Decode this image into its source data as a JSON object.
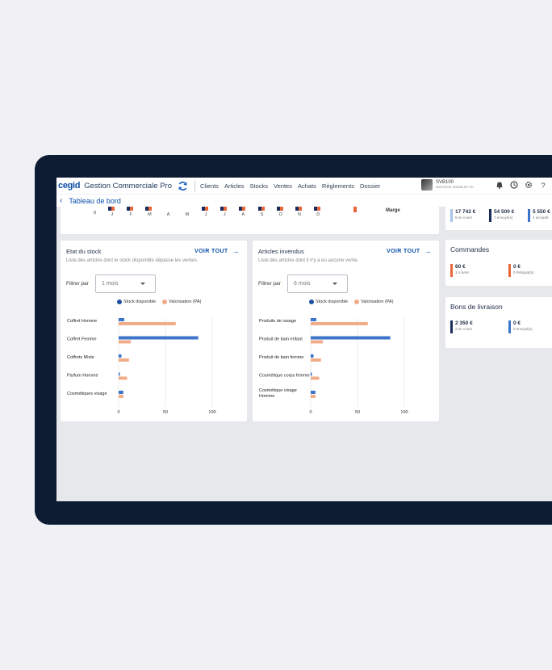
{
  "header": {
    "logo": "cegid",
    "app_name": "Gestion Commerciale Pro",
    "nav": [
      "Clients",
      "Articles",
      "Stocks",
      "Ventes",
      "Achats",
      "Règlements",
      "Dossier"
    ],
    "user_code": "SVB100",
    "user_sub": "SUCCESS VISION BY FD"
  },
  "breadcrumb": {
    "title": "Tableau de bord"
  },
  "top_strip": {
    "zero_label": "0",
    "months": [
      "J",
      "F",
      "M",
      "A",
      "M",
      "J",
      "J",
      "A",
      "S",
      "O",
      "N",
      "D"
    ],
    "marge_label": "Marge"
  },
  "stock_panel": {
    "title": "Etat du stock",
    "voir_tout": "VOIR TOUT",
    "description": "Liste des articles dont le stock disponible dépasse les ventes.",
    "filter_label": "Filtrer par",
    "filter_value": "1 mois",
    "legend": [
      "Stock disponible",
      "Valorisation (PA)"
    ]
  },
  "unsold_panel": {
    "title": "Articles invendus",
    "voir_tout": "VOIR TOUT",
    "description": "Liste des articles dont il n'y a eu aucune vente.",
    "filter_label": "Filtrer par",
    "filter_value": "6 mois",
    "legend": [
      "Stock disponible",
      "Valorisation (PA)"
    ]
  },
  "chart_data": [
    {
      "type": "bar",
      "orientation": "horizontal",
      "categories": [
        "Coffret Homme",
        "Coffret Femme",
        "Coffrets Mixte",
        "Parfum Homme",
        "Cosmétiques visage"
      ],
      "series": [
        {
          "name": "Stock disponible",
          "values": [
            6,
            85,
            3,
            1,
            5
          ]
        },
        {
          "name": "Valorisation (PA)",
          "values": [
            61,
            13,
            11,
            9,
            5
          ]
        }
      ],
      "xticks": [
        "0",
        "50",
        "100"
      ],
      "xlim": [
        0,
        100
      ]
    },
    {
      "type": "bar",
      "orientation": "horizontal",
      "categories": [
        "Produits de rasage",
        "Produit de bain enfant",
        "Produit de bain femme",
        "Cosmétique corps femme",
        "Cosmétique visage Homme"
      ],
      "series": [
        {
          "name": "Stock disponible",
          "values": [
            6,
            85,
            3,
            1,
            5
          ]
        },
        {
          "name": "Valorisation (PA)",
          "values": [
            61,
            13,
            11,
            9,
            5
          ]
        }
      ],
      "xticks": [
        "0",
        "50",
        "100"
      ],
      "xlim": [
        0,
        100
      ]
    }
  ],
  "colors": {
    "stock": "#3b74c9",
    "valorisation": "#f0ad88",
    "navy": "#1a2d5a",
    "orange": "#e8663a"
  },
  "top_card": {
    "kpis": [
      {
        "value": "17 742 €",
        "label": "5 en cours",
        "color": "#a9c4e8"
      },
      {
        "value": "54 500 €",
        "label": "7 envoyé(s)",
        "color": "#1a2d5a"
      },
      {
        "value": "5 550 €",
        "label": "4 accepté",
        "color": "#3b74c9"
      }
    ]
  },
  "commandes": {
    "title": "Commandes",
    "kpis": [
      {
        "value": "60 €",
        "label": "1 A livrer",
        "color": "#e8663a"
      },
      {
        "value": "0 €",
        "label": "0 Reliquat(s)",
        "color": "#e8663a"
      }
    ]
  },
  "bons_livraison": {
    "title": "Bons de livraison",
    "kpis": [
      {
        "value": "2 350 €",
        "label": "2 en cours",
        "color": "#1a2d5a"
      },
      {
        "value": "0 €",
        "label": "0 envoyé(s)",
        "color": "#3b74c9"
      }
    ]
  }
}
